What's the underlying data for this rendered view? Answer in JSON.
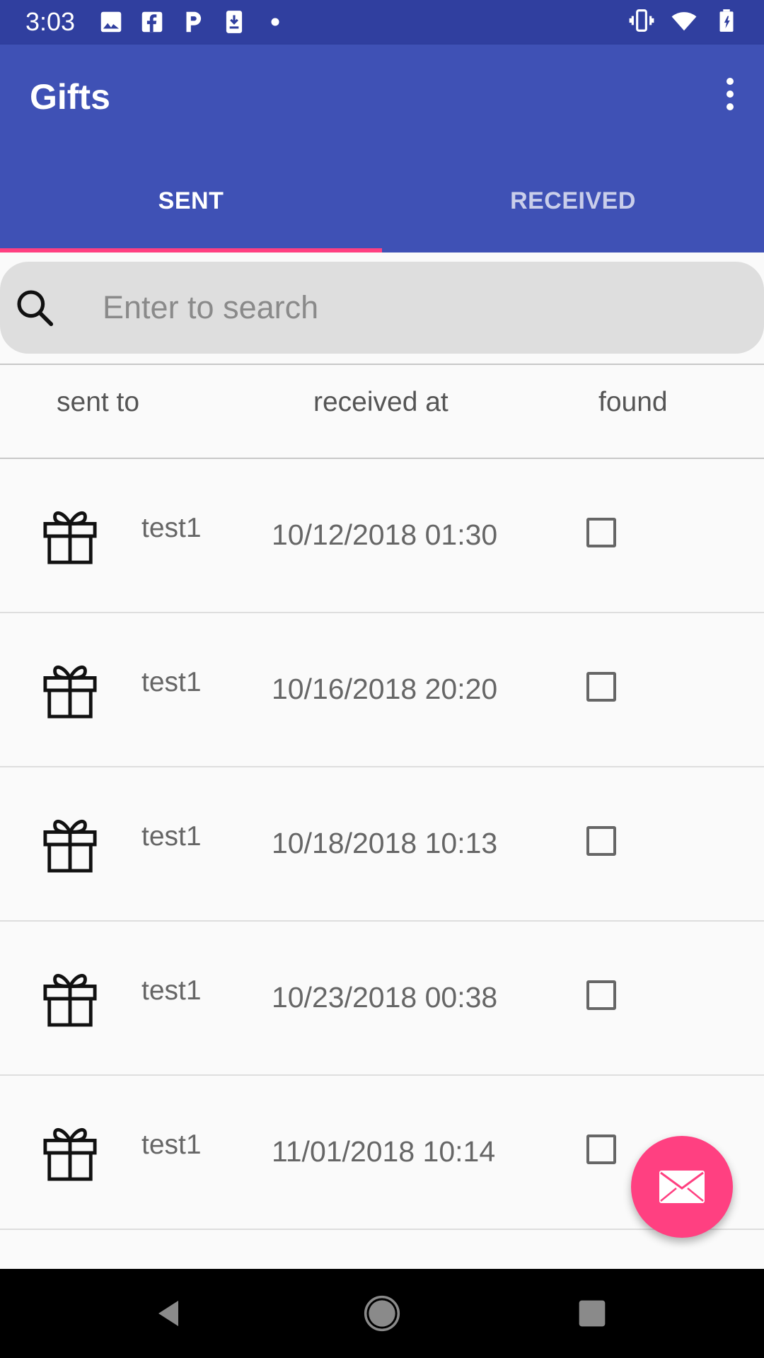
{
  "status_bar": {
    "time": "3:03",
    "notification_icons": [
      "image-icon",
      "facebook-icon",
      "pandora-icon",
      "download-icon",
      "dot-icon"
    ],
    "system_icons": [
      "vibrate-icon",
      "wifi-icon",
      "battery-icon"
    ]
  },
  "app_bar": {
    "title": "Gifts",
    "overflow_icon": "more-vert-icon"
  },
  "tabs": [
    {
      "label": "SENT",
      "selected": true
    },
    {
      "label": "RECEIVED",
      "selected": false
    }
  ],
  "search": {
    "placeholder": "Enter to search",
    "value": ""
  },
  "table": {
    "headers": [
      "sent to",
      "received at",
      "found"
    ],
    "rows": [
      {
        "icon": "gift-icon",
        "sent_to": "test1",
        "received_at": "10/12/2018 01:30",
        "found": false
      },
      {
        "icon": "gift-icon",
        "sent_to": "test1",
        "received_at": "10/16/2018 20:20",
        "found": false
      },
      {
        "icon": "gift-icon",
        "sent_to": "test1",
        "received_at": "10/18/2018 10:13",
        "found": false
      },
      {
        "icon": "gift-icon",
        "sent_to": "test1",
        "received_at": "10/23/2018 00:38",
        "found": false
      },
      {
        "icon": "gift-icon",
        "sent_to": "test1",
        "received_at": "11/01/2018 10:14",
        "found": false
      }
    ]
  },
  "fab": {
    "icon": "mail-icon"
  },
  "nav_bar": {
    "buttons": [
      "back-icon",
      "home-icon",
      "recents-icon"
    ]
  },
  "colors": {
    "primary": "#3f51b5",
    "primary_dark": "#303f9f",
    "accent": "#ff4081"
  }
}
